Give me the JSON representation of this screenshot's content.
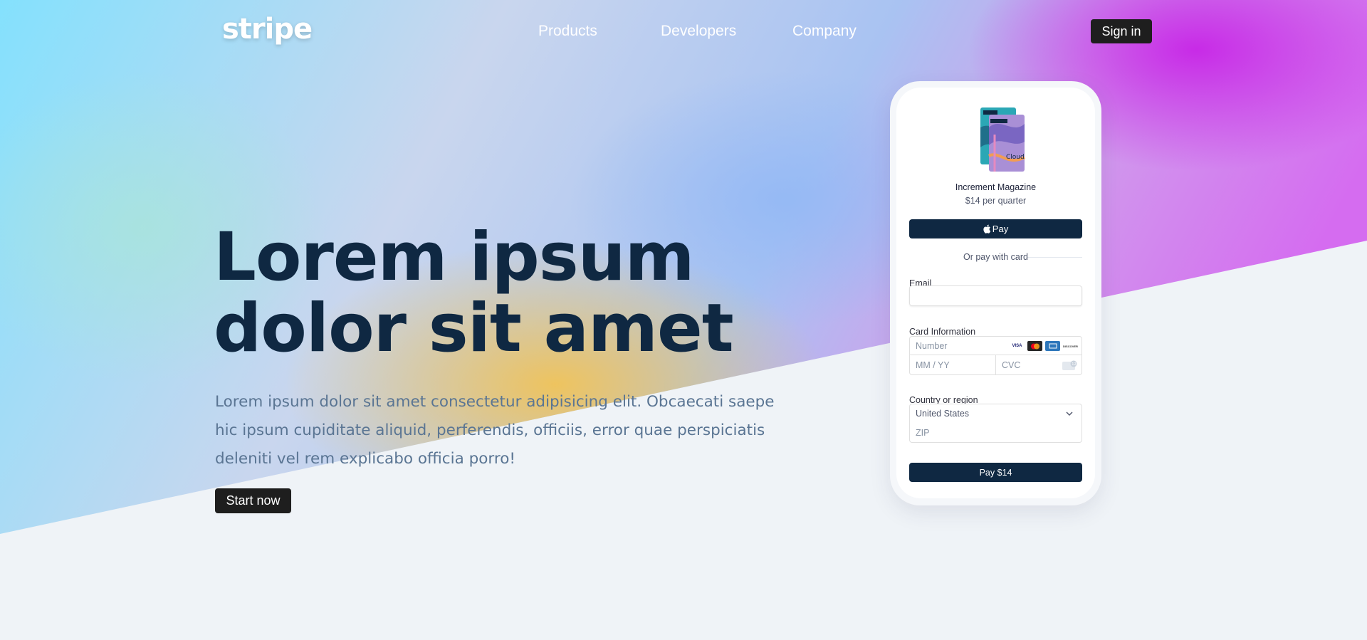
{
  "nav": {
    "logo": "stripe",
    "links": [
      "Products",
      "Developers",
      "Company"
    ],
    "signin_label": "Sign in"
  },
  "hero": {
    "headline_line1": "Lorem ipsum",
    "headline_line2": "dolor sit amet",
    "lead": "Lorem ipsum dolor sit amet consectetur adipisicing elit. Obcaecati saepe hic ipsum cupiditate aliquid, perferendis, officiis, error quae perspiciatis deleniti vel rem explicabo officia porro!",
    "cta_label": "Start now"
  },
  "checkout": {
    "product_name": "Increment Magazine",
    "product_price": "$14 per quarter",
    "magazine_cover_text": "Cloud",
    "applepay_label": "Pay",
    "divider_text": "Or pay with card",
    "email_label": "Email",
    "email_value": "",
    "card_label": "Card Information",
    "card_number_placeholder": "Number",
    "card_exp_placeholder": "MM / YY",
    "card_cvc_placeholder": "CVC",
    "card_brands": [
      "VISA",
      "mastercard",
      "amex",
      "discover"
    ],
    "card_brand_visa_text": "VISA",
    "card_brand_discover_text": "DISCOVER",
    "country_label": "Country or region",
    "country_value": "United States",
    "zip_placeholder": "ZIP",
    "pay_button_label": "Pay $14"
  },
  "colors": {
    "brand_dark": "#0f2842",
    "button_dark": "#1e1e1e",
    "lead_text": "#5a7593",
    "page_bg": "#eff3f7"
  },
  "icons": {
    "apple": "apple-icon",
    "chevron": "chevron-down-icon",
    "cvc": "cvc-card-icon"
  }
}
